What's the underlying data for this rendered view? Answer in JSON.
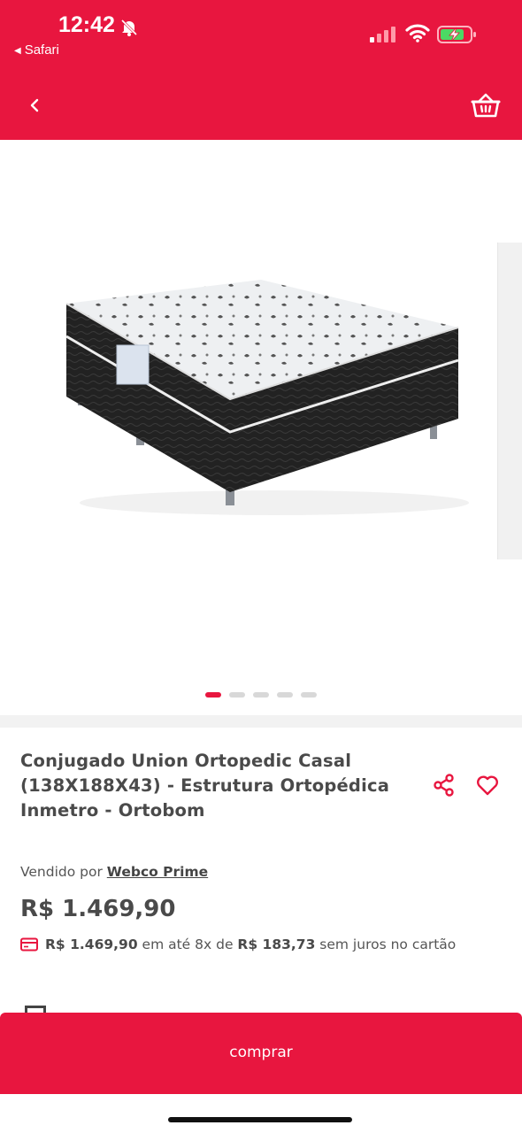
{
  "status_bar": {
    "time": "12:42",
    "back_app": "Safari"
  },
  "colors": {
    "brand_red": "#e8163f",
    "text_dark": "#4a4a4a"
  },
  "icons": [
    "bell-slash-icon",
    "signal-icon",
    "wifi-icon",
    "battery-charging-icon",
    "chevron-left-icon",
    "basket-icon",
    "share-icon",
    "heart-icon",
    "credit-card-icon"
  ],
  "gallery": {
    "slide_count": 5,
    "active_index": 0
  },
  "product": {
    "title": "Conjugado Union Ortopedic Casal (138X188X43) - Estrutura Ortopédica Inmetro - Ortobom",
    "seller_prefix": "Vendido por",
    "seller_name": "Webco Prime",
    "price": "R$ 1.469,90",
    "installment_total": "R$ 1.469,90",
    "installment_mid": "em até 8x de",
    "installment_value": "R$ 183,73",
    "installment_suffix": "sem juros no cartão"
  },
  "cta": {
    "label": "comprar"
  }
}
